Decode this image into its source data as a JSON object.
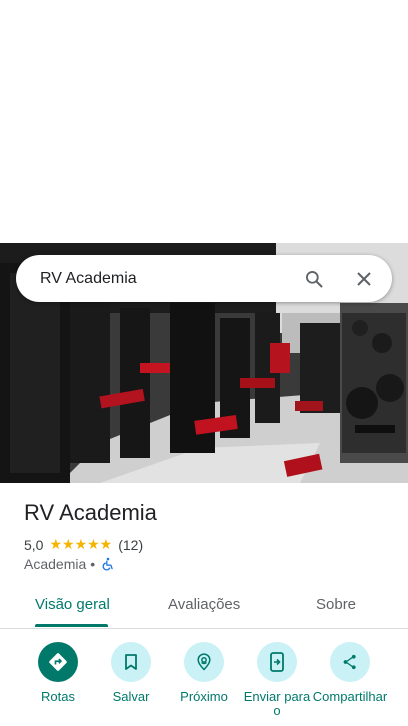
{
  "search": {
    "query": "RV Academia"
  },
  "place": {
    "name": "RV Academia",
    "rating": "5,0",
    "stars": "★★★★★",
    "review_count": "(12)",
    "category": "Academia",
    "separator": "•"
  },
  "tabs": [
    {
      "label": "Visão geral",
      "active": true
    },
    {
      "label": "Avaliações",
      "active": false
    },
    {
      "label": "Sobre",
      "active": false
    }
  ],
  "actions": [
    {
      "label": "Rotas",
      "icon": "directions-icon"
    },
    {
      "label": "Salvar",
      "icon": "bookmark-icon"
    },
    {
      "label": "Próximo",
      "icon": "nearby-icon"
    },
    {
      "label": "Enviar para o",
      "icon": "send-to-phone-icon"
    },
    {
      "label": "Compartilhar",
      "icon": "share-icon"
    }
  ],
  "colors": {
    "accent": "#00796b",
    "chip": "#c9f1f6",
    "star": "#f4b400",
    "wheelchair": "#1a73e8"
  }
}
